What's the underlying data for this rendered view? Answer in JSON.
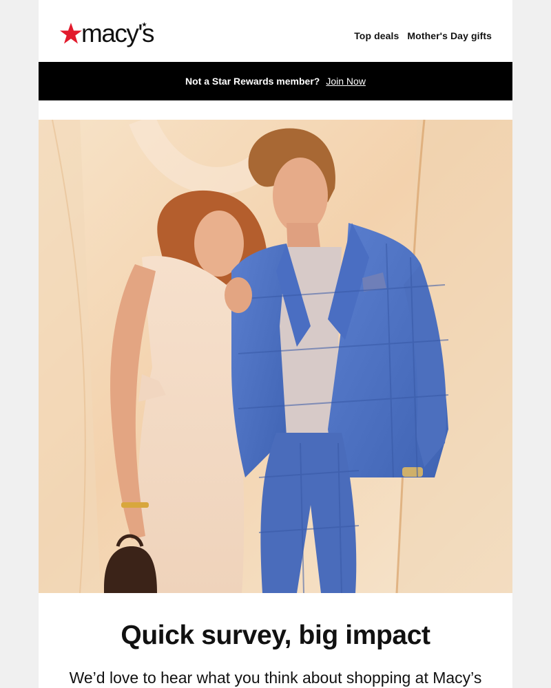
{
  "brand": {
    "logo_text": "macy's"
  },
  "header": {
    "nav": [
      {
        "label": "Top deals"
      },
      {
        "label": "Mother's Day gifts"
      }
    ]
  },
  "promo_bar": {
    "text": "Not a Star Rewards member?",
    "link_label": "Join Now",
    "background": "#000000"
  },
  "hero": {
    "description_icon": "photo-couple-icon"
  },
  "content": {
    "headline": "Quick survey, big impact",
    "subheadline": "We’d love to hear what you think about shopping at Macy’s"
  },
  "colors": {
    "brand_red": "#e21a2c",
    "text": "#111111",
    "page_bg": "#f0f0f0"
  }
}
